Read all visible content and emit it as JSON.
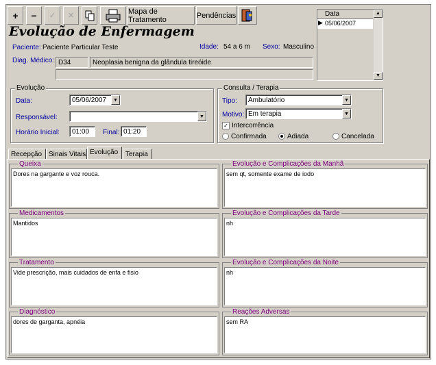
{
  "toolbar": {
    "add": "+",
    "remove": "−",
    "confirm": "✓",
    "cancel": "✕",
    "mapa_label": "Mapa de Tratamento",
    "pendencias_label": "Pendências"
  },
  "header": {
    "title": "Evolução de Enfermagem",
    "paciente_label": "Paciente:",
    "paciente_value": "Paciente Particular Teste",
    "idade_label": "Idade:",
    "idade_value": "54 a 6 m",
    "sexo_label": "Sexo:",
    "sexo_value": "Masculino",
    "diag_label": "Diag. Médico:",
    "diag_code": "D34",
    "diag_desc": "Neoplasia benigna da glândula tireóide",
    "diag_extra": ""
  },
  "date_list": {
    "header": "Data",
    "rows": [
      "05/06/2007"
    ]
  },
  "evolucao": {
    "title": "Evolução",
    "data_label": "Data:",
    "data_value": "05/06/2007",
    "responsavel_label": "Responsável:",
    "responsavel_value": "",
    "horario_label": "Horário Inicial:",
    "horario_value": "01:00",
    "final_label": "Final:",
    "final_value": "01:20"
  },
  "consulta": {
    "title": "Consulta / Terapia",
    "tipo_label": "Tipo:",
    "tipo_value": "Ambulatório",
    "motivo_label": "Motivo:",
    "motivo_value": "Em terapia",
    "intercorrencia_label": "Intercorrência",
    "intercorrencia_checked": true,
    "status_options": [
      "Confirmada",
      "Adiada",
      "Cancelada"
    ],
    "status_selected": "Adiada"
  },
  "tabs": [
    {
      "label": "Recepção"
    },
    {
      "label": "Sinais Vitais"
    },
    {
      "label": "Evolução"
    },
    {
      "label": "Terapia"
    }
  ],
  "active_tab": "Evolução",
  "memos": {
    "queixa": {
      "title": "Queixa",
      "text": "Dores na gargante e voz rouca."
    },
    "manha": {
      "title": "Evolução e Complicações da Manhã",
      "text": "sem qt, somente exame de iodo"
    },
    "medicamentos": {
      "title": "Medicamentos",
      "text": "Mantidos"
    },
    "tarde": {
      "title": "Evolução e Complicações da Tarde",
      "text": "nh"
    },
    "tratamento": {
      "title": "Tratamento",
      "text": "Vide prescrição, mais cuidados de enfa e fisio"
    },
    "noite": {
      "title": "Evolução e Complicações da Noite",
      "text": "nh"
    },
    "diagnostico": {
      "title": "Diagnóstico",
      "text": "dores de garganta, apnéia"
    },
    "reacoes": {
      "title": "Reações Adversas",
      "text": "sem RA"
    }
  },
  "colors": {
    "window": "#d4d0c8",
    "label_blue": "#0000a0",
    "memo_title": "#800080"
  }
}
